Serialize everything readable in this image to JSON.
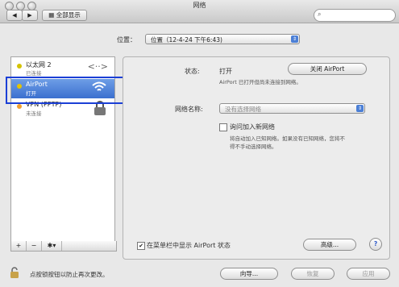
{
  "window": {
    "title": "网络"
  },
  "toolbar": {
    "back": "◀",
    "forward": "▶",
    "show_all": "全部显示"
  },
  "location": {
    "label": "位置：",
    "value": "位置（12-4-24 下午6:43)"
  },
  "sidebar": {
    "items": [
      {
        "name": "以太网 2",
        "status": "已连接",
        "dot_color": "#d4c200"
      },
      {
        "name": "AirPort",
        "status": "打开",
        "dot_color": "#e4c400"
      },
      {
        "name": "VPN (PPTP)",
        "status": "未连接",
        "dot_color": "#f0a030"
      }
    ],
    "tools": [
      "+",
      "−",
      "✱▾"
    ]
  },
  "detail": {
    "status_label": "状态:",
    "status_value": "打开",
    "turn_off_button": "关闭 AirPort",
    "status_desc": "AirPort 已打开但尚未连接到网络。",
    "network_name_label": "网络名称:",
    "network_name_value": "没有选择网络",
    "ask_join_label": "询问加入新网络",
    "ask_join_desc_1": "将自动加入已知网络。如果没有已知网络，您将不",
    "ask_join_desc_2": "得不手动选择网络。",
    "show_in_menu_label": "在菜单栏中显示 AirPort 状态",
    "advanced_button": "高级...",
    "help_button": "?"
  },
  "footer": {
    "lock_text": "点按锁按钮以防止再次更改。",
    "assist_button": "向导...",
    "revert_button": "恢复",
    "apply_button": "应用"
  }
}
